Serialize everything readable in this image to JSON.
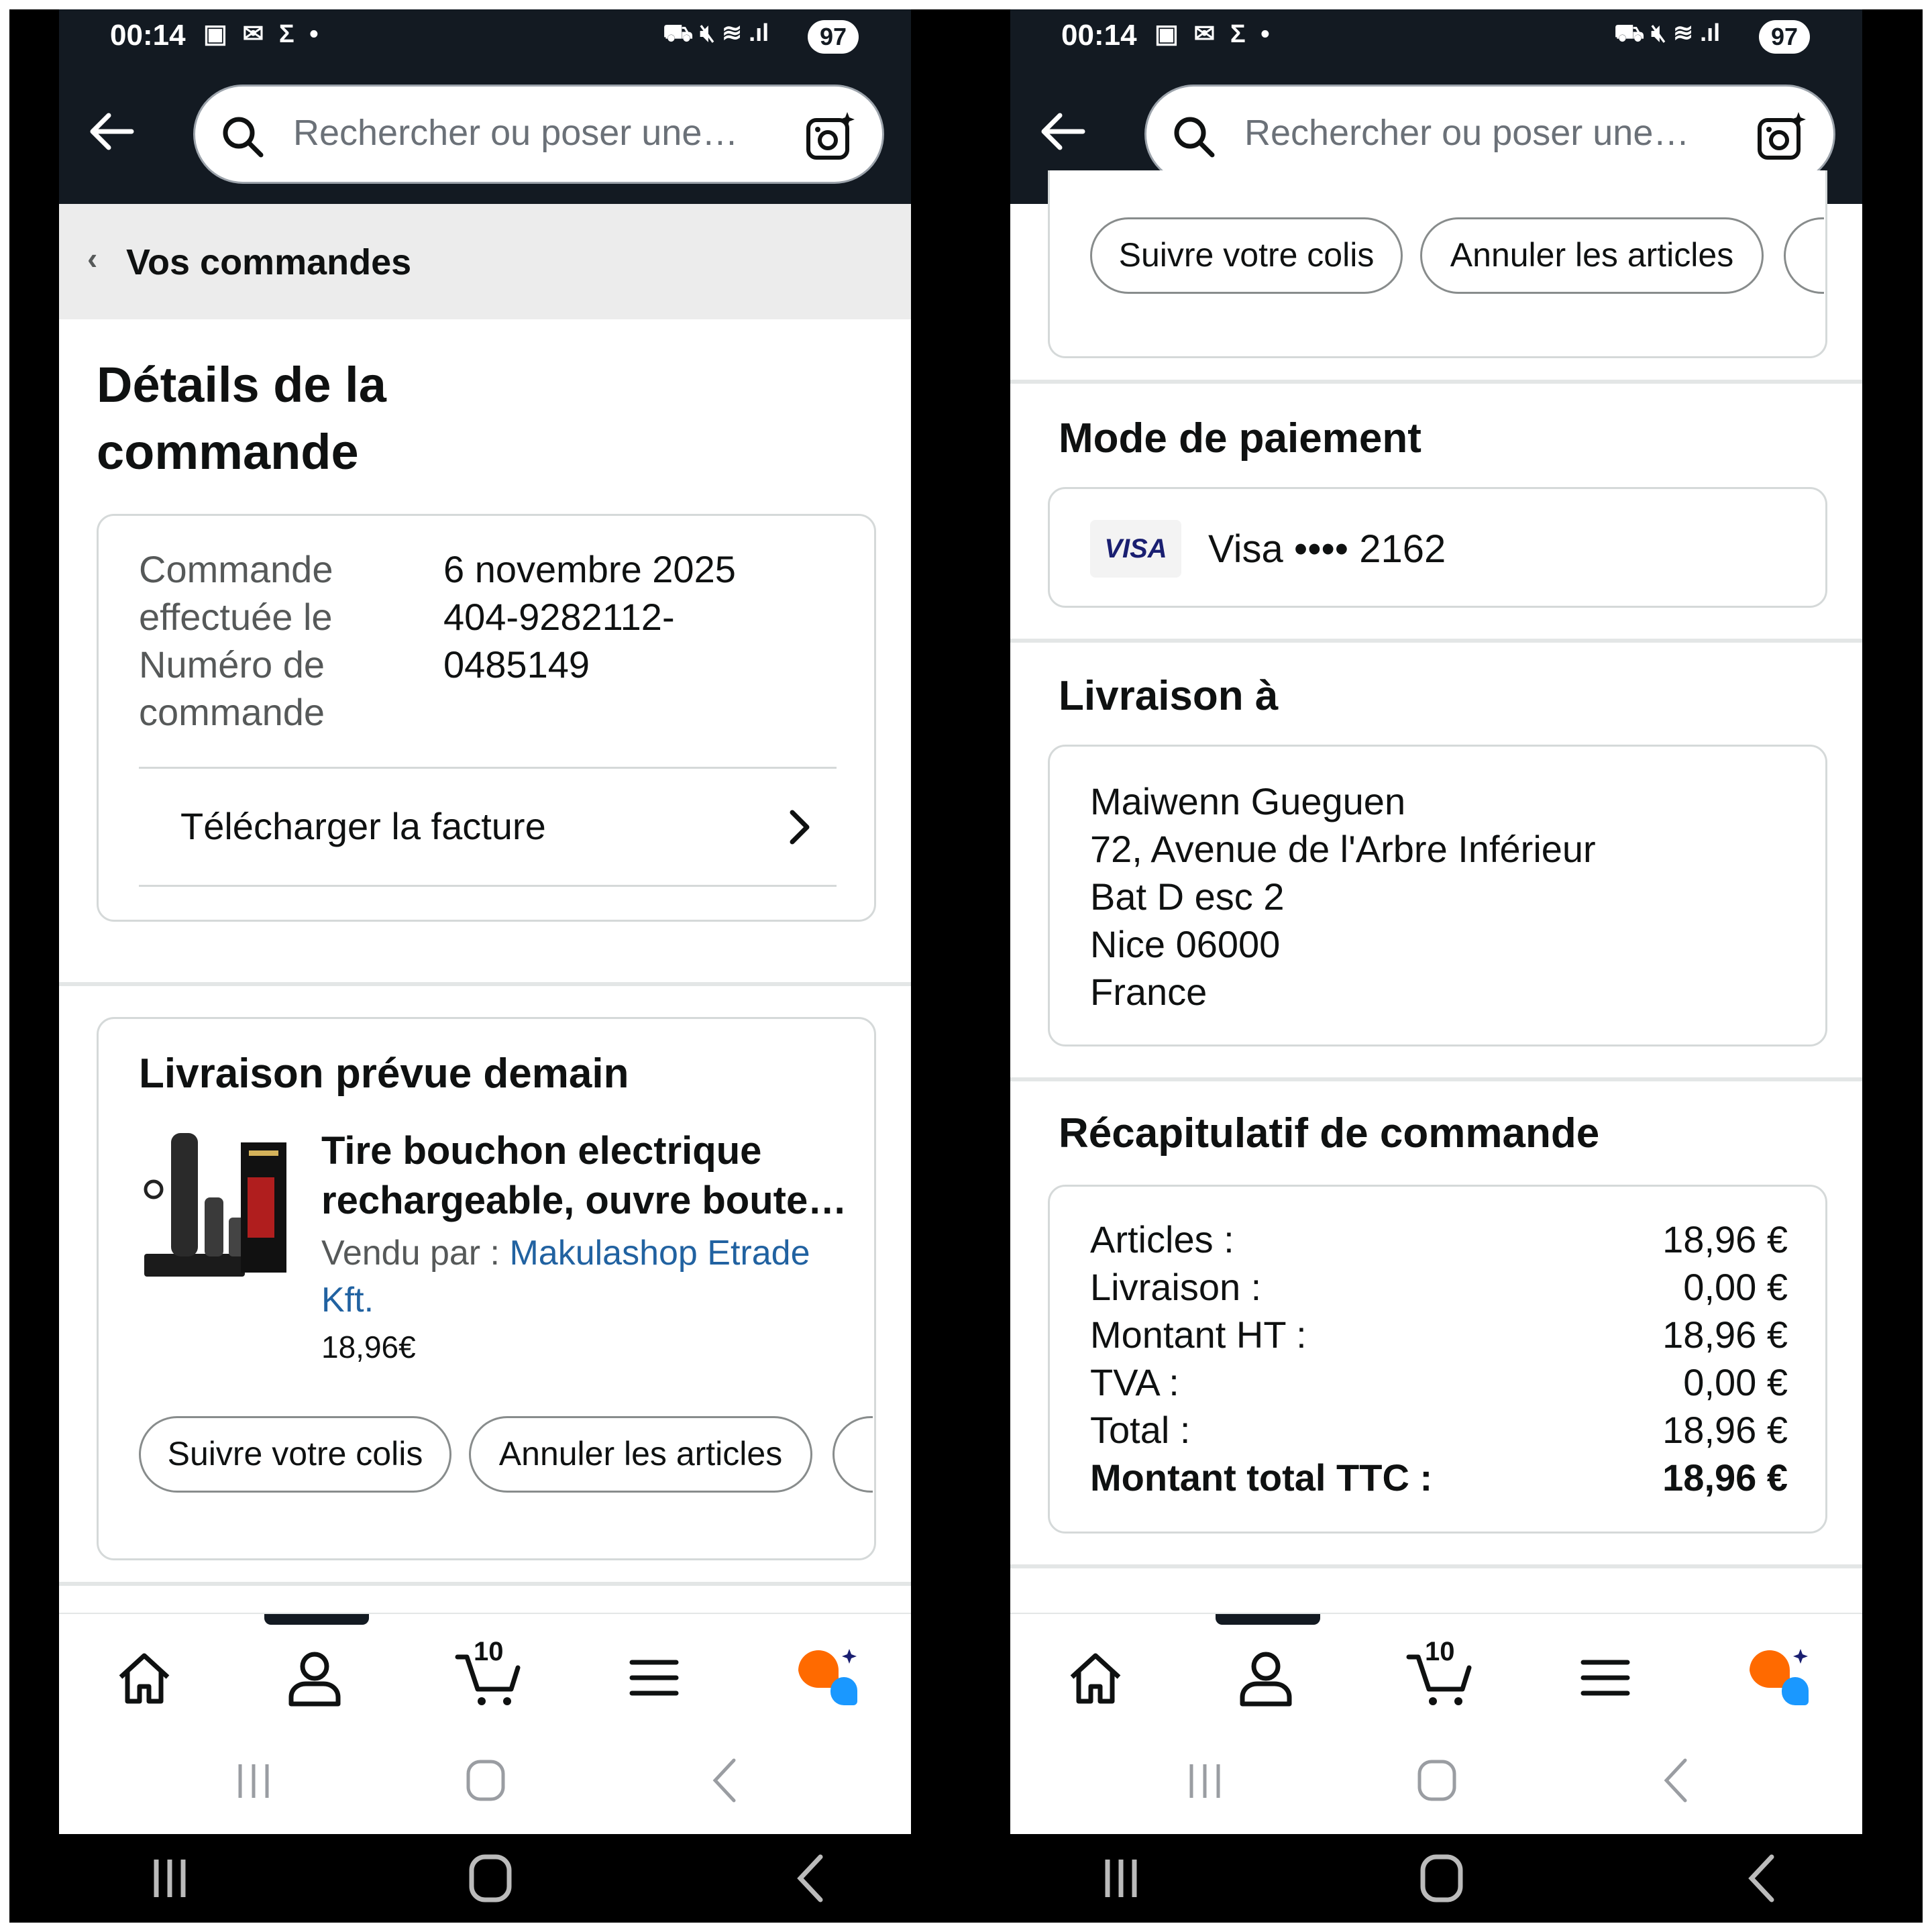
{
  "status": {
    "time": "00:14",
    "battery": "97"
  },
  "search": {
    "placeholder": "Rechercher ou poser une…"
  },
  "left": {
    "breadcrumb": "Vos commandes",
    "title_line1": "Détails de la",
    "title_line2": "commande",
    "order_info": {
      "placed_label_1": "Commande",
      "placed_label_2": "effectuée le",
      "number_label_1": "Numéro de",
      "number_label_2": "commande",
      "date": "6 novembre 2025",
      "number_1": "404-9282112-",
      "number_2": "0485149"
    },
    "invoice_label": "Télécharger la facture",
    "delivery_heading": "Livraison prévue demain",
    "product": {
      "title_1": "Tire bouchon electrique",
      "title_2": "rechargeable, ouvre boute…",
      "sold_by_label": "Vendu par  :",
      "seller_1": "Makulashop Etrade",
      "seller_2": "Kft.",
      "price": "18,96€"
    },
    "track_button": "Suivre votre colis",
    "cancel_button": "Annuler les articles"
  },
  "right": {
    "track_button": "Suivre votre colis",
    "cancel_button": "Annuler les articles",
    "payment_heading": "Mode de paiement",
    "card_brand": "VISA",
    "card_text": "Visa •••• 2162",
    "delivery_heading": "Livraison à",
    "address": [
      "Maiwenn Gueguen",
      "72, Avenue de l'Arbre Inférieur",
      "Bat D esc 2",
      "Nice 06000",
      "France"
    ],
    "summary_heading": "Récapitulatif de commande",
    "summary": [
      {
        "label": "Articles :",
        "value": "18,96 €"
      },
      {
        "label": "Livraison :",
        "value": "0,00 €"
      },
      {
        "label": "Montant HT :",
        "value": "18,96 €"
      },
      {
        "label": "TVA :",
        "value": "0,00 €"
      },
      {
        "label": "Total :",
        "value": "18,96 €"
      },
      {
        "label": "Montant total TTC :",
        "value": "18,96 €"
      }
    ]
  },
  "bottom_nav": {
    "cart_count": "10"
  },
  "colors": {
    "header": "#131a22",
    "link": "#2162a1",
    "rufus_orange": "#ff6a00",
    "rufus_blue": "#1a98ff",
    "visa_blue": "#1a1f71"
  }
}
